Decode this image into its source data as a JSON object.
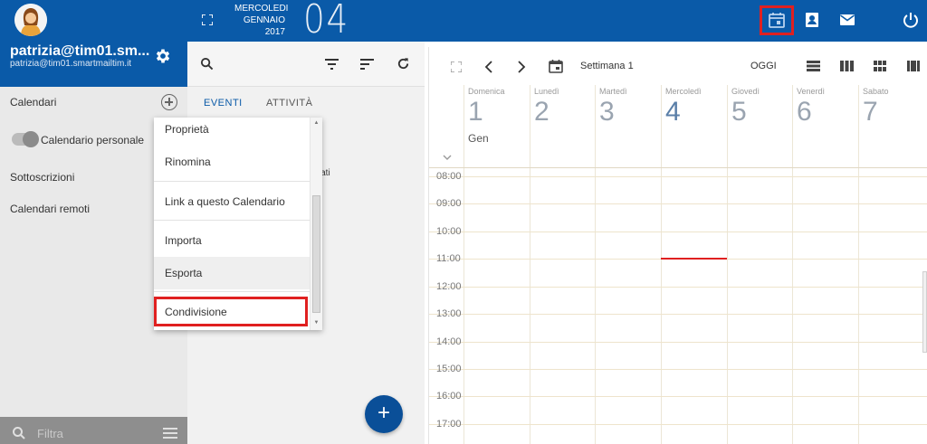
{
  "sidebar": {
    "user_name": "patrizia@tim01.sm...",
    "user_email": "patrizia@tim01.smartmailtim.it",
    "calendars_label": "Calendari",
    "personal_calendar": "Calendario personale",
    "subscriptions": "Sottoscrizioni",
    "remote_calendars": "Calendari remoti",
    "filter_placeholder": "Filtra"
  },
  "topbar": {
    "weekday": "MERCOLEDI",
    "month": "GENNAIO",
    "year": "2017",
    "day": "04"
  },
  "middle": {
    "tabs": [
      {
        "label": "EVENTI"
      },
      {
        "label": "ATTIVITÀ"
      }
    ],
    "partial_text": "onati",
    "fab_label": "+"
  },
  "context_menu": {
    "items": [
      {
        "label": "Proprietà"
      },
      {
        "label": "Rinomina"
      },
      {
        "label": "Link a questo Calendario"
      },
      {
        "label": "Importa"
      },
      {
        "label": "Esporta"
      },
      {
        "label": "Condivisione"
      }
    ]
  },
  "calendar": {
    "week_label": "Settimana 1",
    "today_label": "OGGI",
    "month_label": "Gen",
    "days": [
      {
        "name": "Domenica",
        "num": "1"
      },
      {
        "name": "Lunedì",
        "num": "2"
      },
      {
        "name": "Martedì",
        "num": "3"
      },
      {
        "name": "Mercoledì",
        "num": "4"
      },
      {
        "name": "Giovedì",
        "num": "5"
      },
      {
        "name": "Venerdì",
        "num": "6"
      },
      {
        "name": "Sabato",
        "num": "7"
      }
    ],
    "hours": [
      "08:00",
      "09:00",
      "10:00",
      "11:00",
      "12:00",
      "13:00",
      "14:00",
      "15:00",
      "16:00",
      "17:00"
    ]
  },
  "colors": {
    "brand_blue": "#0a5aa8",
    "highlight_red": "#e02020"
  }
}
